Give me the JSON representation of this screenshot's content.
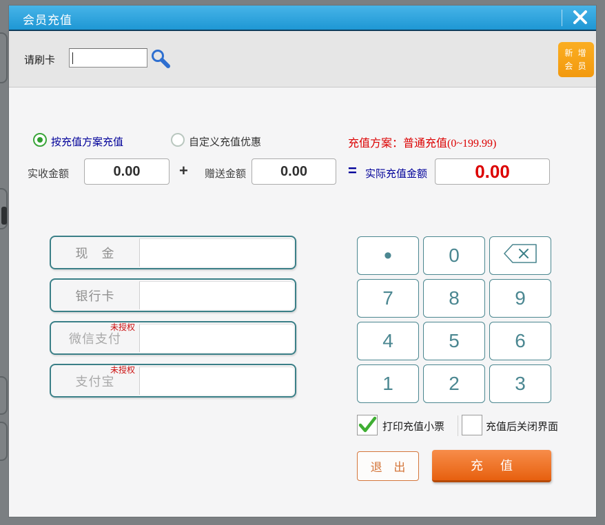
{
  "dialog": {
    "title": "会员充值"
  },
  "header": {
    "swipe_label": "请刷卡",
    "swipe_input": {
      "value": "",
      "placeholder": ""
    },
    "add_member_button": {
      "line1": "新 增",
      "line2": "会 员"
    }
  },
  "recharge_mode": {
    "by_scheme_label": "按充值方案充值",
    "by_scheme_selected": true,
    "custom_label": "自定义充值优惠",
    "custom_selected": false,
    "scheme_info": "充值方案：普通充值(0~199.99)"
  },
  "amounts": {
    "received_label": "实收金额",
    "received_value": "0.00",
    "plus_sign": "+",
    "gift_label": "赠送金额",
    "gift_value": "0.00",
    "equals_sign": "=",
    "actual_label": "实际充值金额",
    "actual_value": "0.00"
  },
  "payments": [
    {
      "label": "现　金",
      "value": "",
      "badge": ""
    },
    {
      "label": "银行卡",
      "value": "",
      "badge": ""
    },
    {
      "label": "微信支付",
      "value": "",
      "badge": "未授权"
    },
    {
      "label": "支付宝",
      "value": "",
      "badge": "未授权"
    }
  ],
  "keypad": {
    "rows": [
      [
        "•",
        "0",
        "⌫"
      ],
      [
        "7",
        "8",
        "9"
      ],
      [
        "4",
        "5",
        "6"
      ],
      [
        "1",
        "2",
        "3"
      ]
    ]
  },
  "options": {
    "print_receipt_label": "打印充值小票",
    "print_receipt_checked": true,
    "close_after_label": "充值后关闭界面",
    "close_after_checked": false
  },
  "actions": {
    "exit_label": "退 出",
    "recharge_label": "充 值"
  },
  "colors": {
    "titlebar_blue": "#2aa7e0",
    "accent_orange": "#f7a01d",
    "recharge_orange": "#ec6c11",
    "keypad_teal": "#3a7f87",
    "alert_red": "#dc0000",
    "navy_label": "#000099",
    "radio_green": "#3aa53a"
  }
}
